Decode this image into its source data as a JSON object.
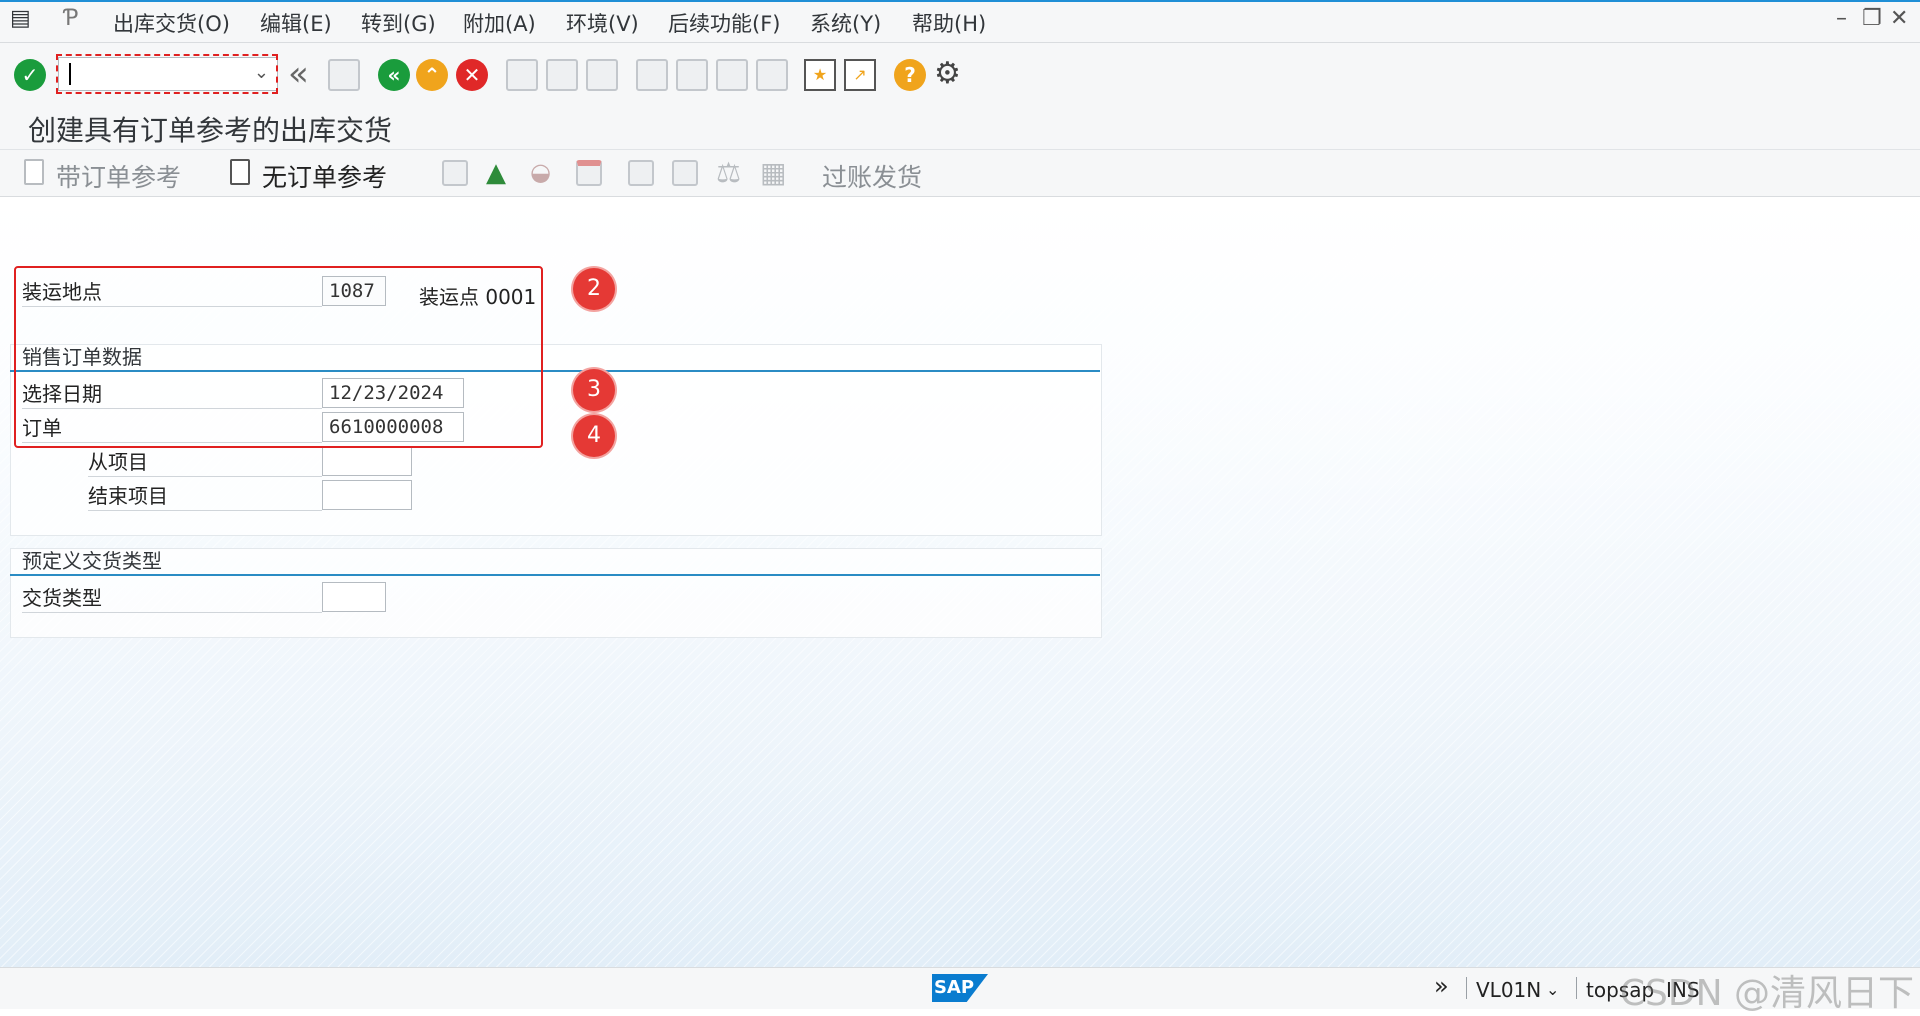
{
  "menu": {
    "items": [
      "出库交货(O)",
      "编辑(E)",
      "转到(G)",
      "附加(A)",
      "环境(V)",
      "后续功能(F)",
      "系统(Y)",
      "帮助(H)"
    ]
  },
  "window_controls": {
    "minimize": "–",
    "restore": "❐",
    "close": "✕"
  },
  "toolbar": {
    "command_value": ""
  },
  "title": "创建具有订单参考的出库交货",
  "app_toolbar": {
    "with_order_ref": "带订单参考",
    "without_order_ref": "无订单参考",
    "post_goods_issue": "过账发货"
  },
  "form": {
    "shipping_point": {
      "label": "装运地点",
      "value": "1087",
      "desc": "装运点 0001"
    },
    "sales_order_section": "销售订单数据",
    "selection_date": {
      "label": "选择日期",
      "value": "12/23/2024"
    },
    "order": {
      "label": "订单",
      "value": "6610000008"
    },
    "from_item": {
      "label": "从项目",
      "value": ""
    },
    "to_item": {
      "label": "结束项目",
      "value": ""
    },
    "delivery_type_section": "预定义交货类型",
    "delivery_type": {
      "label": "交货类型",
      "value": ""
    }
  },
  "markers": [
    "2",
    "3",
    "4"
  ],
  "status": {
    "logo": "SAP",
    "expand": "»",
    "tcode": "VL01N",
    "user": "topsap",
    "mode": "INS",
    "watermark": "CSDN @清风日下"
  },
  "colors": {
    "accent": "#2a8cc4",
    "highlight": "#e02020",
    "marker": "#e53935"
  }
}
